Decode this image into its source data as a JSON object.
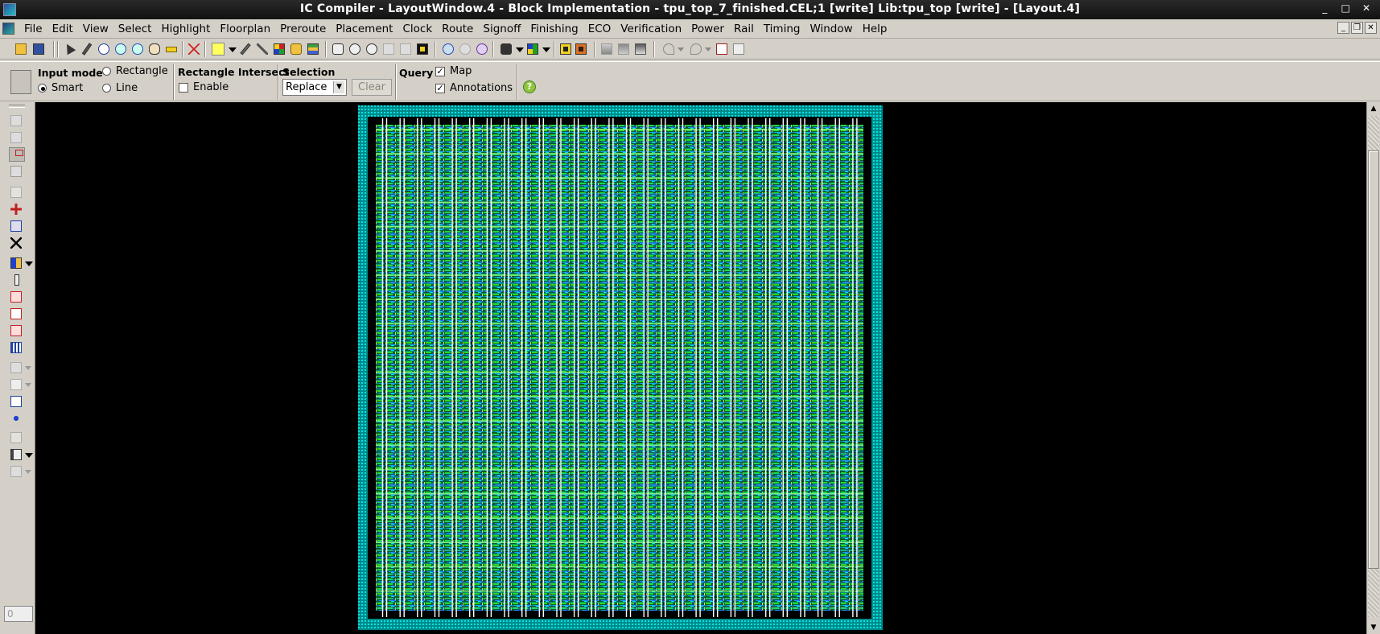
{
  "window": {
    "title": "IC Compiler - LayoutWindow.4 - Block Implementation - tpu_top_7_finished.CEL;1 [write]     Lib:tpu_top [write] - [Layout.4]",
    "controls": [
      "_",
      "□",
      "✕"
    ]
  },
  "menubar": {
    "items": [
      "File",
      "Edit",
      "View",
      "Select",
      "Highlight",
      "Floorplan",
      "Preroute",
      "Placement",
      "Clock",
      "Route",
      "Signoff",
      "Finishing",
      "ECO",
      "Verification",
      "Power",
      "Rail",
      "Timing",
      "Window",
      "Help"
    ],
    "mdi_controls": [
      "_",
      "❐",
      "✕"
    ]
  },
  "options": {
    "input_mode": {
      "label": "Input mode",
      "options": [
        "Rectangle",
        "Smart",
        "Line"
      ],
      "selected": "Smart"
    },
    "rectangle_intersect": {
      "label": "Rectangle Intersect",
      "enable_label": "Enable",
      "enabled": false
    },
    "selection": {
      "label": "Selection",
      "mode": "Replace",
      "clear_label": "Clear"
    },
    "query": {
      "label": "Query",
      "map_label": "Map",
      "map_checked": true,
      "annotations_label": "Annotations",
      "annotations_checked": true
    },
    "help_icon": "help-icon"
  },
  "left_toolbar": {
    "field_value": "0"
  },
  "colors": {
    "canvas_bg": "#000000",
    "chip_cyan": "#00e5e5",
    "chip_green": "#22dd22",
    "chip_blue": "#2244ff",
    "chip_white": "#ffffff",
    "title_bg": "#1a1a1a",
    "chrome_bg": "#d4d0c8"
  },
  "layout_view": {
    "power_straps_vertical": 28,
    "power_rails_horizontal": 60
  }
}
